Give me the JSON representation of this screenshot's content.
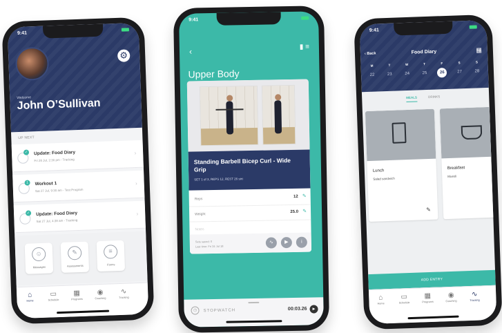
{
  "phone1": {
    "status_time": "9:41",
    "welcome": "Welcome",
    "name": "John O’Sullivan",
    "up_next_label": "UP NEXT",
    "tasks": [
      {
        "title": "Update: Food Diary",
        "sub": "Fri 28 Jul, 2:30 pm - Tracking",
        "badge": "✓"
      },
      {
        "title": "Workout 1",
        "sub": "Sat 27 Jul, 9:30 am - Test Program",
        "badge": "1"
      },
      {
        "title": "Update: Food Diary",
        "sub": "Sat 27 Jul, 4:38 am - Tracking",
        "badge": "✓"
      }
    ],
    "shortcuts": [
      {
        "label": "Messages",
        "icon": "chat-icon"
      },
      {
        "label": "Assessments",
        "icon": "pencil-icon"
      },
      {
        "label": "Forms",
        "icon": "document-icon"
      }
    ],
    "tabs": [
      "Home",
      "Schedule",
      "Programs",
      "Coaching",
      "Tracking"
    ]
  },
  "phone2": {
    "status_time": "9:41",
    "title": "Upper Body",
    "exercise_title": "Standing Barbell Bicep Curl - Wide Grip",
    "exercise_meta": "SET 1 of 3, REPS 12, REST 26 sec",
    "reps_label": "Reps",
    "reps_value": "12",
    "weight_label": "Weight",
    "weight_value": "25.0",
    "notes_label": "Notes",
    "sets_saved": "Sets saved: 0",
    "last_time": "Last time: Fri 24 Jul 18",
    "stopwatch_label": "STOPWATCH",
    "stopwatch_time": "00:03.26"
  },
  "phone3": {
    "status_time": "9:41",
    "back_label": "Back",
    "title": "Food Diary",
    "days": [
      {
        "name": "M",
        "num": "22"
      },
      {
        "name": "T",
        "num": "23"
      },
      {
        "name": "W",
        "num": "24"
      },
      {
        "name": "T",
        "num": "25"
      },
      {
        "name": "F",
        "num": "26"
      },
      {
        "name": "S",
        "num": "27"
      },
      {
        "name": "S",
        "num": "28"
      }
    ],
    "selected_day_index": 4,
    "tab_meals": "MEALS",
    "tab_drinks": "DRINKS",
    "meals": [
      {
        "title": "Lunch",
        "desc": "Salad sandwich"
      },
      {
        "title": "Breakfast",
        "desc": "Muesli"
      }
    ],
    "add_entry": "ADD ENTRY",
    "tabs": [
      "Home",
      "Schedule",
      "Programs",
      "Coaching",
      "Tracking"
    ]
  },
  "colors": {
    "navy": "#2b3a67",
    "teal": "#3cb9a8"
  }
}
